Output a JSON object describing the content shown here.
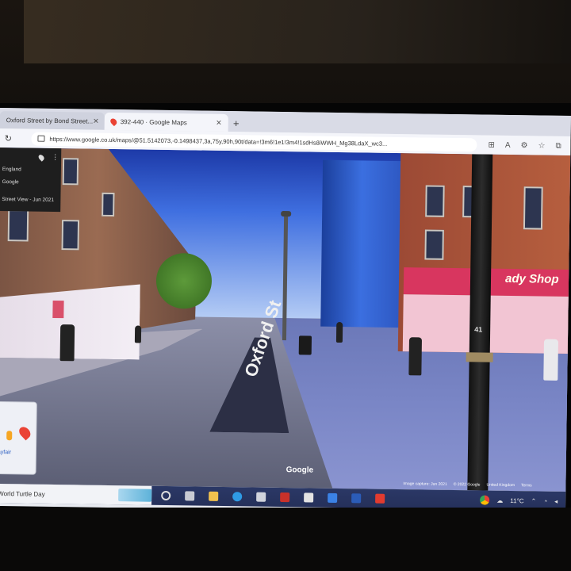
{
  "browser": {
    "tabs": [
      {
        "label": "Oxford Street by Bond Street...",
        "active": false
      },
      {
        "label": "392-440 · Google Maps",
        "active": true
      }
    ],
    "new_tab_label": "+",
    "url": "https://www.google.co.uk/maps/@51.5142073,-0.1498437,3a,75y,90h,90t/data=!3m6!1e1!3m4!1sdHs8iWWH_Mg38LdaX_wc3..."
  },
  "street_view": {
    "info_card": {
      "line1": "England",
      "line2": "Google",
      "line3": "Street View - Jun 2021"
    },
    "street_marking": "Oxford St",
    "pole_sign": "41",
    "shop_sign": "ady Shop",
    "minimap_label": "ayfair",
    "google_logo": "Google",
    "attribution": [
      "Image capture: Jun 2021",
      "© 2022 Google",
      "United Kingdom",
      "Terms"
    ]
  },
  "taskbar": {
    "search_text": "World Turtle Day",
    "weather": "11°C",
    "icons": [
      "task-view-icon",
      "file-explorer-icon",
      "edge-icon",
      "store-icon",
      "app-red-icon",
      "app-doc-icon",
      "app-blue-icon",
      "word-icon",
      "acrobat-icon",
      "chrome-icon"
    ]
  },
  "colors": {
    "taskbar": "#25305a",
    "tab_active": "#f4f5fa",
    "maps_pin": "#ea4335"
  }
}
